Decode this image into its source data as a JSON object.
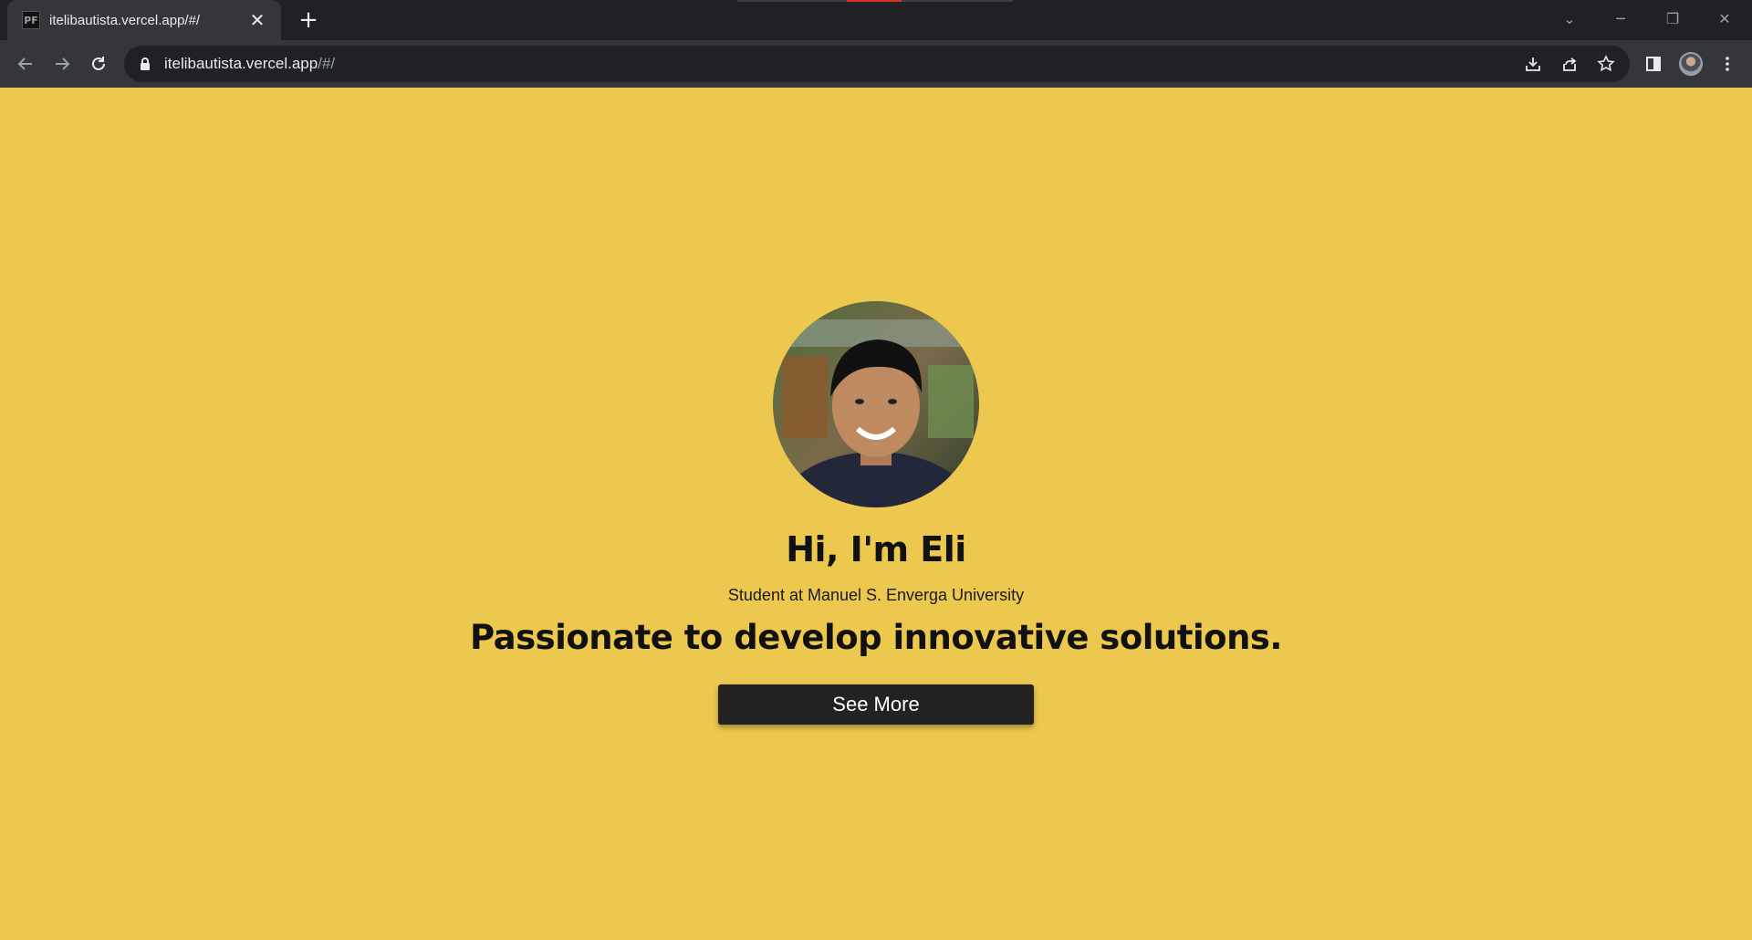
{
  "browser": {
    "tab": {
      "favicon_text": "PF",
      "title": "itelibautista.vercel.app/#/",
      "close_glyph": "✕"
    },
    "new_tab_glyph": "+",
    "window_controls": {
      "tab_search_glyph": "⌄",
      "minimize_glyph": "─",
      "restore_glyph": "❐",
      "close_glyph": "✕"
    },
    "address": {
      "host": "itelibautista.vercel.app",
      "path": "/#/"
    },
    "icons": [
      "back-arrow-icon",
      "forward-arrow-icon",
      "reload-icon",
      "lock-icon",
      "install-icon",
      "share-icon",
      "bookmark-star-icon",
      "side-panel-icon",
      "profile-avatar",
      "menu-dots-icon"
    ]
  },
  "page": {
    "background_color": "#ecc84e",
    "greeting": "Hi, I'm Eli",
    "subtitle": "Student at Manuel S. Enverga University",
    "tagline": "Passionate to develop innovative solutions.",
    "cta_label": "See More",
    "cta_color": "#222222"
  }
}
